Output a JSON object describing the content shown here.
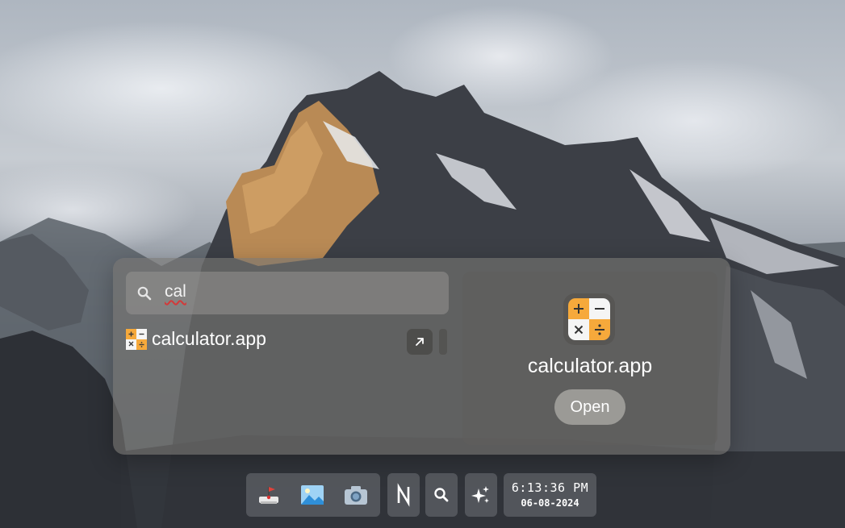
{
  "launcher": {
    "search": {
      "value": "cal"
    },
    "results": [
      {
        "label": "calculator.app",
        "icon": "calculator-icon"
      }
    ],
    "preview": {
      "title": "calculator.app",
      "open_label": "Open",
      "icon": "calculator-icon"
    }
  },
  "taskbar": {
    "apps": [
      {
        "name": "drawing-app-icon"
      },
      {
        "name": "photos-app-icon"
      },
      {
        "name": "camera-app-icon"
      },
      {
        "name": "notes-n-icon"
      },
      {
        "name": "search-icon"
      },
      {
        "name": "sparkles-ai-icon"
      }
    ],
    "clock": {
      "time": "6:13:36 PM",
      "date": "06-08-2024"
    }
  },
  "colors": {
    "calc_orange": "#f6a93b",
    "calc_white": "#f5f5f5",
    "spellcheck_red": "#d23a3a"
  }
}
